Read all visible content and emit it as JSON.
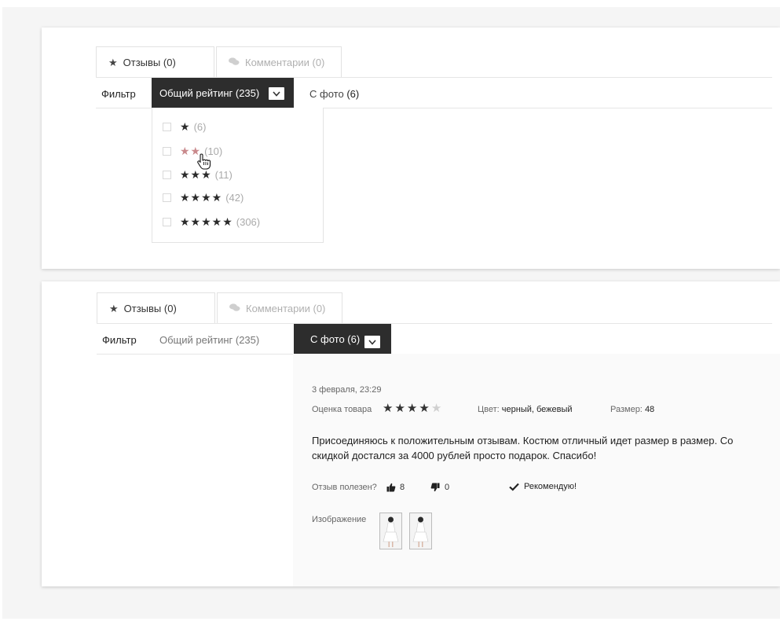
{
  "panel1": {
    "tabs": [
      {
        "label": "Отзывы (0)",
        "icon": "star-icon"
      },
      {
        "label": "Комментарии (0)",
        "icon": "comments-icon"
      }
    ],
    "filter": {
      "label": "Фильтр",
      "rating_button": "Общий рейтинг (235)",
      "photo_label": "С фото",
      "photo_count": "(6)"
    },
    "rating_options": [
      {
        "stars": "★",
        "count": "(6)"
      },
      {
        "stars": "★★",
        "count": "(10)"
      },
      {
        "stars": "★★★",
        "count": "(11)"
      },
      {
        "stars": "★★★★",
        "count": "(42)"
      },
      {
        "stars": "★★★★★",
        "count": "(306)"
      }
    ]
  },
  "panel2": {
    "tabs": [
      {
        "label": "Отзывы (0)",
        "icon": "star-icon"
      },
      {
        "label": "Комментарии (0)",
        "icon": "comments-icon"
      }
    ],
    "filter": {
      "label": "Фильтр",
      "rating_label": "Общий рейтинг (235)",
      "photo_button": "С фото (6)"
    },
    "review": {
      "date": "3 февраля, 23:29",
      "rating_label": "Оценка товара",
      "rating_value": 4,
      "rating_max": 5,
      "color_label": "Цвет:",
      "color_value": "черный, бежевый",
      "size_label": "Размер:",
      "size_value": "48",
      "text": "Присоединяюсь к положительным отзывам. Костюм отличный идет размер в размер. Со скидкой достался за 4000 рублей просто подарок. Спасибо!",
      "helpful_label": "Отзыв полезен?",
      "likes": "8",
      "dislikes": "0",
      "recommend_label": "Рекомендую!",
      "images_label": "Изображение"
    }
  },
  "colors": {
    "dark": "#2d2d2d",
    "star_hover": "#c9898c",
    "muted": "#b0b0b0"
  }
}
